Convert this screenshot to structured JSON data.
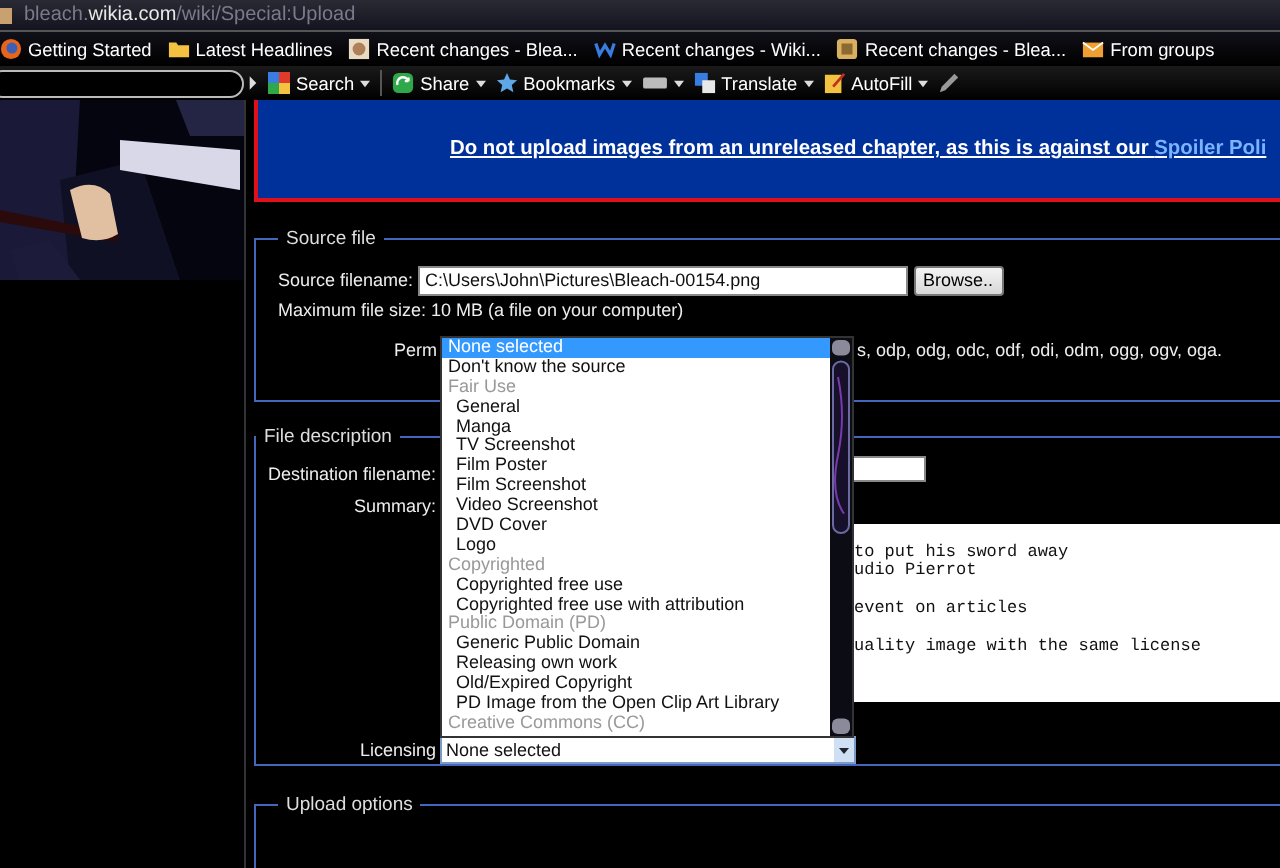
{
  "address_bar": {
    "url": "bleach.**wikia.com**/wiki/Special:Upload"
  },
  "bookmarks": [
    {
      "label": "Getting Started",
      "kind": "firefox"
    },
    {
      "label": "Latest Headlines",
      "kind": "feed"
    },
    {
      "label": "Recent changes - Blea...",
      "kind": "avatar"
    },
    {
      "label": "Recent changes - Wiki...",
      "kind": "wiki"
    },
    {
      "label": "Recent changes - Blea...",
      "kind": "page"
    },
    {
      "label": "From groups",
      "kind": "mail"
    }
  ],
  "toolbar": [
    {
      "label": "Search",
      "kind": "google",
      "menu": true
    },
    {
      "label": "Share",
      "kind": "share",
      "menu": true
    },
    {
      "label": "Bookmarks",
      "kind": "star",
      "menu": true
    },
    {
      "kind": "box",
      "menu": true
    },
    {
      "label": "Translate",
      "kind": "translate",
      "menu": true
    },
    {
      "label": "AutoFill",
      "kind": "autofill",
      "menu": true
    },
    {
      "kind": "pencil",
      "menu": false
    }
  ],
  "banner": {
    "text": "Do not upload images from an unreleased chapter, as this is against our ",
    "link": "Spoiler Poli"
  },
  "source_file": {
    "legend": "Source file",
    "filename_label": "Source filename:",
    "filename_value": "C:\\Users\\John\\Pictures\\Bleach-00154.png",
    "browse_button": "Browse..",
    "max_size": "Maximum file size: 10 MB (a file on your computer)",
    "permitted_start": "Perm",
    "permitted_end": "s, odp, odg, odc, odf, odi, odm, ogg, ogv, oga."
  },
  "file_description": {
    "legend": "File description",
    "destination_label": "Destination filename:",
    "summary_label": "Summary:",
    "summary_text": "to put his sword away\nudio Pierrot\n\nevent on articles\n\nuality image with the same license",
    "licensing_label": "Licensing",
    "licensing_value": "None selected"
  },
  "licensing_dropdown": {
    "options": [
      {
        "label": "None selected",
        "kind": "option",
        "selected": true
      },
      {
        "label": "Don't know the source",
        "kind": "option",
        "selected": false
      },
      {
        "label": "Fair Use",
        "kind": "group",
        "selected": false
      },
      {
        "label": "General",
        "kind": "suboption",
        "selected": false
      },
      {
        "label": "Manga",
        "kind": "suboption",
        "selected": false
      },
      {
        "label": "TV Screenshot",
        "kind": "suboption",
        "selected": false
      },
      {
        "label": "Film Poster",
        "kind": "suboption",
        "selected": false
      },
      {
        "label": "Film Screenshot",
        "kind": "suboption",
        "selected": false
      },
      {
        "label": "Video Screenshot",
        "kind": "suboption",
        "selected": false
      },
      {
        "label": "DVD Cover",
        "kind": "suboption",
        "selected": false
      },
      {
        "label": "Logo",
        "kind": "suboption",
        "selected": false
      },
      {
        "label": "Copyrighted",
        "kind": "group",
        "selected": false
      },
      {
        "label": "Copyrighted free use",
        "kind": "suboption",
        "selected": false
      },
      {
        "label": "Copyrighted free use with attribution",
        "kind": "suboption",
        "selected": false
      },
      {
        "label": "Public Domain (PD)",
        "kind": "group",
        "selected": false
      },
      {
        "label": "Generic Public Domain",
        "kind": "suboption",
        "selected": false
      },
      {
        "label": "Releasing own work",
        "kind": "suboption",
        "selected": false
      },
      {
        "label": "Old/Expired Copyright",
        "kind": "suboption",
        "selected": false
      },
      {
        "label": "PD Image from the Open Clip Art Library",
        "kind": "suboption",
        "selected": false
      },
      {
        "label": "Creative Commons (CC)",
        "kind": "group",
        "selected": false
      }
    ]
  },
  "upload_options": {
    "legend": "Upload options"
  }
}
